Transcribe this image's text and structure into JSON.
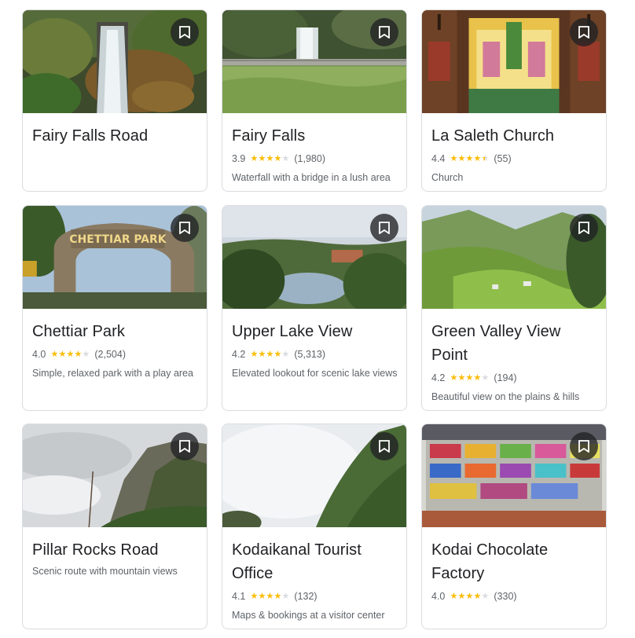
{
  "colors": {
    "star": "#fbbc04",
    "star_empty": "#dadce0",
    "save_bg": "#202124"
  },
  "places": [
    {
      "name": "Fairy Falls Road",
      "rating": "",
      "stars": null,
      "reviews": "",
      "description": "",
      "photo": "waterfall-forest"
    },
    {
      "name": "Fairy Falls",
      "rating": "3.9",
      "stars": 3.9,
      "reviews": "(1,980)",
      "description": "Waterfall with a bridge in a lush area",
      "photo": "waterfall-bridge"
    },
    {
      "name": "La Saleth Church",
      "rating": "4.4",
      "stars": 4.4,
      "reviews": "(55)",
      "description": "Church",
      "photo": "church-altar"
    },
    {
      "name": "Chettiar Park",
      "rating": "4.0",
      "stars": 4.0,
      "reviews": "(2,504)",
      "description": "Simple, relaxed park with a play area",
      "photo": "park-gate",
      "sign_text": "CHETTIAR PARK"
    },
    {
      "name": "Upper Lake View",
      "rating": "4.2",
      "stars": 4.2,
      "reviews": "(5,313)",
      "description": "Elevated lookout for scenic lake views",
      "photo": "lake-view"
    },
    {
      "name": "Green Valley View Point",
      "rating": "4.2",
      "stars": 4.2,
      "reviews": "(194)",
      "description": "Beautiful view on the plains & hills",
      "photo": "green-valley"
    },
    {
      "name": "Pillar Rocks Road",
      "rating": "",
      "stars": null,
      "reviews": "",
      "description": "Scenic route with mountain views",
      "photo": "pillar-rocks"
    },
    {
      "name": "Kodaikanal Tourist Office",
      "rating": "4.1",
      "stars": 4.1,
      "reviews": "(132)",
      "description": "Maps & bookings at a visitor center",
      "photo": "misty-hills"
    },
    {
      "name": "Kodai Chocolate Factory",
      "rating": "4.0",
      "stars": 4.0,
      "reviews": "(330)",
      "description": "",
      "photo": "chocolate-display"
    }
  ]
}
